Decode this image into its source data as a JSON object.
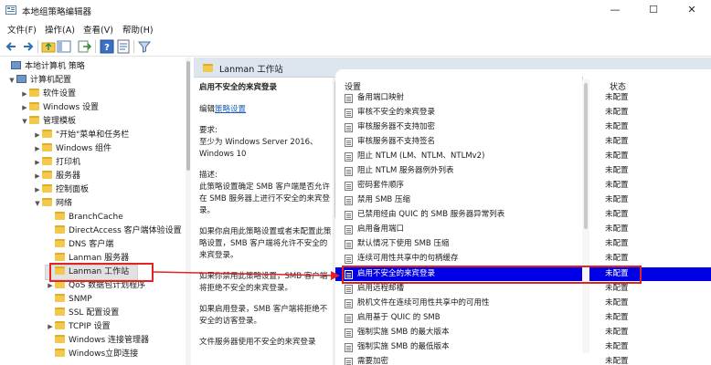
{
  "window": {
    "title": "本地组策略编辑器",
    "minimize_label": "—",
    "maximize_label": "☐",
    "close_label": "✕"
  },
  "menu": {
    "items": [
      "文件(F)",
      "操作(A)",
      "查看(V)",
      "帮助(H)"
    ]
  },
  "toolbar": {
    "buttons": [
      "back-icon",
      "forward-icon",
      "up-folder-icon",
      "show-hide-tree-icon",
      "export-list-icon",
      "help-icon",
      "properties-icon",
      "filter-icon"
    ]
  },
  "tree": {
    "items": [
      {
        "label": "本地计算机 策略",
        "arrow": "",
        "icon": "computer"
      },
      {
        "label": "计算机配置",
        "arrow": "▼",
        "icon": "computer"
      },
      {
        "label": "软件设置",
        "arrow": "▶",
        "icon": "folder"
      },
      {
        "label": "Windows 设置",
        "arrow": "▶",
        "icon": "folder"
      },
      {
        "label": "管理模板",
        "arrow": "▼",
        "icon": "folder"
      },
      {
        "label": "\"开始\"菜单和任务栏",
        "arrow": "▶",
        "icon": "folder"
      },
      {
        "label": "Windows 组件",
        "arrow": "▶",
        "icon": "folder"
      },
      {
        "label": "打印机",
        "arrow": "▶",
        "icon": "folder"
      },
      {
        "label": "服务器",
        "arrow": "▶",
        "icon": "folder"
      },
      {
        "label": "控制面板",
        "arrow": "▶",
        "icon": "folder"
      },
      {
        "label": "网络",
        "arrow": "▼",
        "icon": "folder"
      },
      {
        "label": "BranchCache",
        "arrow": "",
        "icon": "folder"
      },
      {
        "label": "DirectAccess 客户端体验设置",
        "arrow": "",
        "icon": "folder"
      },
      {
        "label": "DNS 客户端",
        "arrow": "",
        "icon": "folder"
      },
      {
        "label": "Lanman 服务器",
        "arrow": "",
        "icon": "folder"
      },
      {
        "label": "Lanman 工作站",
        "arrow": "",
        "icon": "folder"
      },
      {
        "label": "QoS 数据包计划程序",
        "arrow": "▶",
        "icon": "folder"
      },
      {
        "label": "SNMP",
        "arrow": "",
        "icon": "folder"
      },
      {
        "label": "SSL 配置设置",
        "arrow": "",
        "icon": "folder"
      },
      {
        "label": "TCPIP 设置",
        "arrow": "▶",
        "icon": "folder"
      },
      {
        "label": "Windows 连接管理器",
        "arrow": "",
        "icon": "folder"
      },
      {
        "label": "Windows立即连接",
        "arrow": "",
        "icon": "folder"
      }
    ],
    "selected_index": 15
  },
  "right_header": {
    "title": "Lanman 工作站"
  },
  "description": {
    "heading": "启用不安全的来宾登录",
    "edit_prefix": "编辑",
    "edit_link": "策略设置",
    "requirement_label": "要求:",
    "requirement_text": "至少为 Windows Server 2016、Windows 10",
    "desc_label": "描述:",
    "para1": "此策略设置确定 SMB 客户端是否允许在 SMB 服务器上进行不安全的来宾登录。",
    "para2": "如果你启用此策略设置或者未配置此策略设置，SMB 客户端将允许不安全的来宾登录。",
    "para3": "如果你禁用此策略设置，SMB 客户端将拒绝不安全的来宾登录。",
    "para4": "如果启用登录，SMB 客户端将拒绝不安全的访客登录。",
    "para5": "文件服务器使用不安全的来宾登录"
  },
  "list": {
    "col_setting": "设置",
    "col_state": "状态",
    "rows": [
      {
        "name": "备用端口映射",
        "state": "未配置"
      },
      {
        "name": "审核不安全的来宾登录",
        "state": "未配置"
      },
      {
        "name": "审核服务器不支持加密",
        "state": "未配置"
      },
      {
        "name": "审核服务器不支持签名",
        "state": "未配置"
      },
      {
        "name": "阻止 NTLM (LM、NTLM、NTLMv2)",
        "state": "未配置"
      },
      {
        "name": "阻止 NTLM 服务器例外列表",
        "state": "未配置"
      },
      {
        "name": "密码套件顺序",
        "state": "未配置"
      },
      {
        "name": "禁用 SMB 压缩",
        "state": "未配置"
      },
      {
        "name": "已禁用经由 QUIC 的 SMB 服务器异常列表",
        "state": "未配置"
      },
      {
        "name": "启用备用端口",
        "state": "未配置"
      },
      {
        "name": "默认情况下使用 SMB 压缩",
        "state": "未配置"
      },
      {
        "name": "连续可用性共享中的句柄缓存",
        "state": "未配置"
      },
      {
        "name": "启用不安全的来宾登录",
        "state": "未配置"
      },
      {
        "name": "启用远程邮槽",
        "state": "未配置"
      },
      {
        "name": "脱机文件在连续可用性共享中的可用性",
        "state": "未配置"
      },
      {
        "name": "启用基于 QUIC 的 SMB",
        "state": "未配置"
      },
      {
        "name": "强制实施 SMB 的最大版本",
        "state": "未配置"
      },
      {
        "name": "强制实施 SMB 的最低版本",
        "state": "未配置"
      },
      {
        "name": "需要加密",
        "state": "未配置"
      }
    ],
    "selected_index": 12
  },
  "colors": {
    "selection": "#0000e6",
    "annotation": "#e02424",
    "folder": "#f2c94c"
  }
}
